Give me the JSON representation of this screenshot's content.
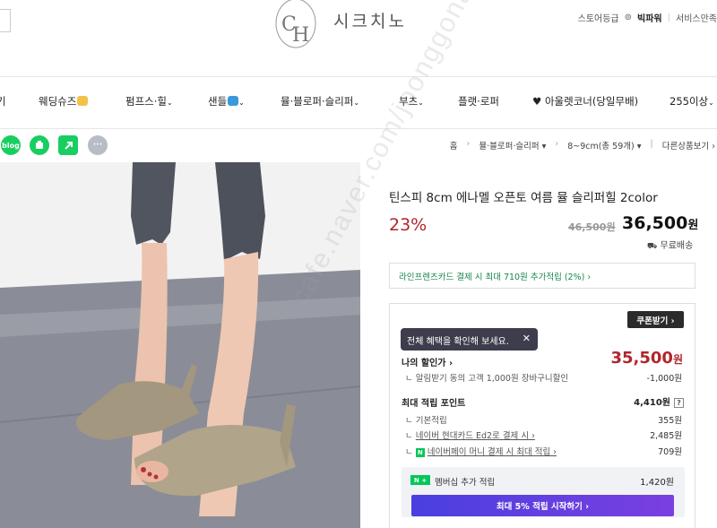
{
  "brand": {
    "logo_letters": "CH",
    "name": "시크치노"
  },
  "top_links": {
    "store_grade": "스토어등급",
    "grade_name": "빅파워",
    "service": "서비스만족"
  },
  "nav": {
    "items": [
      {
        "label": "기",
        "chevron": false
      },
      {
        "label": "웨딩슈즈",
        "chevron": false
      },
      {
        "label": "펌프스·힐",
        "chevron": true
      },
      {
        "label": "샌들",
        "chevron": true
      },
      {
        "label": "뮬·블로퍼·슬리퍼",
        "chevron": true
      },
      {
        "label": "부츠",
        "chevron": true
      },
      {
        "label": "플랫·로퍼",
        "chevron": false
      },
      {
        "label": "♥ 아울렛코너(당일무배)",
        "chevron": false
      },
      {
        "label": "255이상",
        "chevron": true
      }
    ]
  },
  "share": {
    "blog": "blog",
    "more": "···"
  },
  "breadcrumb": {
    "home": "홈",
    "cat": "뮬·블로퍼·슬리퍼",
    "sub": "8~9cm(총 59개)",
    "other": "다른상품보기"
  },
  "product": {
    "title": "틴스피 8cm 에나멜 오픈토 여름 뮬 슬리퍼힐 2color",
    "discount": "23%",
    "original_price": "46,500원",
    "price": "36,500",
    "price_unit": "원",
    "shipping": "무료배송"
  },
  "card_promo": {
    "text": "라인프렌즈카드 결제 시 최대 710원 추가적립 (2%) ›"
  },
  "benefits": {
    "coupon_button": "쿠폰받기 ›",
    "tooltip": "전체 혜택을 확인해 보세요.",
    "tooltip_close": "✕",
    "my_price_label": "나의 할인가 ›",
    "my_price": "35,500",
    "my_price_unit": "원",
    "alarm_label": "알림받기 동의 고객 1,000원 장바구니할인",
    "alarm_value": "-1,000원",
    "points_label": "최대 적립 포인트",
    "points_value": "4,410원",
    "help": "?",
    "basic_label": "기본적립",
    "basic_value": "355원",
    "hyundai_label": "네이버 현대카드 Ed2로 결제 시 ›",
    "hyundai_value": "2,485원",
    "npay_label": "네이버페이 머니 결제 시 최대 적립 ›",
    "npay_value": "709원",
    "member_badge": "N +",
    "member_label": "멤버십 추가 적립",
    "member_value": "1,420원",
    "start_button": "최대 5% 적립 시작하기 ›"
  },
  "watermark": "cafe.naver.com/joonggonara"
}
